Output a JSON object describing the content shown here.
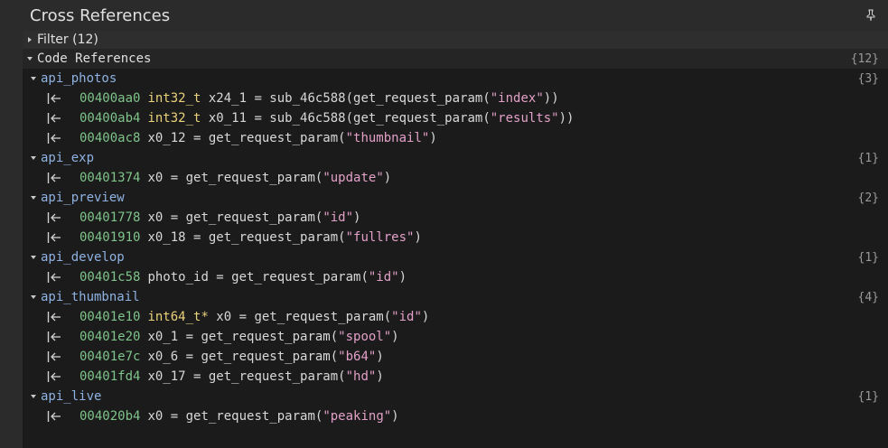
{
  "window": {
    "title": "Cross References",
    "pin_icon": "pin-icon"
  },
  "filter": {
    "label": "Filter (12)"
  },
  "code_references": {
    "label": "Code References",
    "count": "{12}"
  },
  "groups": [
    {
      "name": "api_photos",
      "count": "{3}",
      "refs": [
        {
          "addr": "00400aa0",
          "type": "int32_t",
          "text": " x24_1 = sub_46c588(get_request_param(",
          "str": "\"index\"",
          "tail": "))"
        },
        {
          "addr": "00400ab4",
          "type": "int32_t",
          "text": " x0_11 = sub_46c588(get_request_param(",
          "str": "\"results\"",
          "tail": "))"
        },
        {
          "addr": "00400ac8",
          "type": "",
          "text": "x0_12 = get_request_param(",
          "str": "\"thumbnail\"",
          "tail": ")"
        }
      ]
    },
    {
      "name": "api_exp",
      "count": "{1}",
      "refs": [
        {
          "addr": "00401374",
          "type": "",
          "text": "x0 = get_request_param(",
          "str": "\"update\"",
          "tail": ")"
        }
      ]
    },
    {
      "name": "api_preview",
      "count": "{2}",
      "refs": [
        {
          "addr": "00401778",
          "type": "",
          "text": "x0 = get_request_param(",
          "str": "\"id\"",
          "tail": ")"
        },
        {
          "addr": "00401910",
          "type": "",
          "text": "x0_18 = get_request_param(",
          "str": "\"fullres\"",
          "tail": ")"
        }
      ]
    },
    {
      "name": "api_develop",
      "count": "{1}",
      "refs": [
        {
          "addr": "00401c58",
          "type": "",
          "text": "photo_id = get_request_param(",
          "str": "\"id\"",
          "tail": ")"
        }
      ]
    },
    {
      "name": "api_thumbnail",
      "count": "{4}",
      "refs": [
        {
          "addr": "00401e10",
          "type": "int64_t*",
          "text": " x0 = get_request_param(",
          "str": "\"id\"",
          "tail": ")"
        },
        {
          "addr": "00401e20",
          "type": "",
          "text": "x0_1 = get_request_param(",
          "str": "\"spool\"",
          "tail": ")"
        },
        {
          "addr": "00401e7c",
          "type": "",
          "text": "x0_6 = get_request_param(",
          "str": "\"b64\"",
          "tail": ")"
        },
        {
          "addr": "00401fd4",
          "type": "",
          "text": "x0_17 = get_request_param(",
          "str": "\"hd\"",
          "tail": ")"
        }
      ]
    },
    {
      "name": "api_live",
      "count": "{1}",
      "refs": [
        {
          "addr": "004020b4",
          "type": "",
          "text": "x0 = get_request_param(",
          "str": "\"peaking\"",
          "tail": ")"
        }
      ]
    }
  ]
}
